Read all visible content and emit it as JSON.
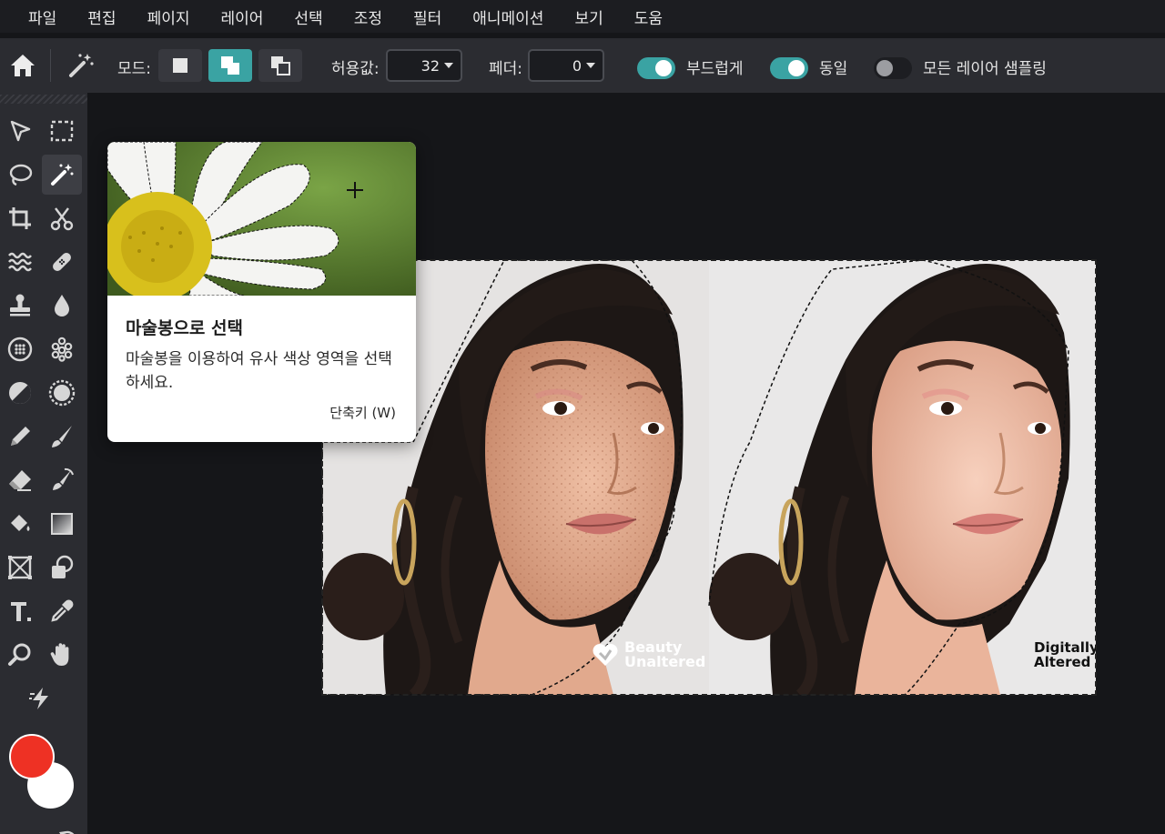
{
  "menu": [
    "파일",
    "편집",
    "페이지",
    "레이어",
    "선택",
    "조정",
    "필터",
    "애니메이션",
    "보기",
    "도움"
  ],
  "options": {
    "mode_label": "모드:",
    "tolerance_label": "허용값:",
    "tolerance_value": "32",
    "feather_label": "페더:",
    "feather_value": "0",
    "smooth_label": "부드럽게",
    "smooth_on": true,
    "contiguous_label": "동일",
    "contiguous_on": true,
    "sample_all_label": "모든 레이어 샘플링",
    "sample_all_on": false,
    "active_mode": "add"
  },
  "tools": [
    "move",
    "marquee",
    "lasso",
    "magic-wand",
    "crop",
    "cut",
    "liquify",
    "heal",
    "clone-stamp",
    "blur",
    "pixelate",
    "sponge",
    "dodge-burn",
    "sharpen",
    "pencil",
    "brush",
    "eraser",
    "color-replace",
    "fill",
    "gradient",
    "frame",
    "shape",
    "text",
    "eyedropper",
    "zoom",
    "hand",
    "quick-actions"
  ],
  "active_tool": "magic-wand",
  "colors": {
    "foreground": "#ee3124",
    "background": "#ffffff",
    "accent": "#3aa3a3"
  },
  "tooltip": {
    "title": "마술봉으로 선택",
    "description": "마술봉을 이용하여 유사 색상 영역을 선택하세요.",
    "shortcut": "단축키 (W)"
  },
  "canvas": {
    "watermark_left_1": "Beauty",
    "watermark_left_2": "Unaltered",
    "watermark_right_1": "Digitally",
    "watermark_right_2": "Altered"
  }
}
